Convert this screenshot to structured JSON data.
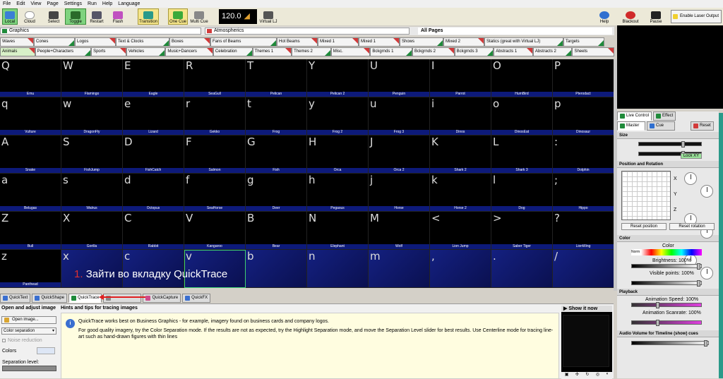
{
  "menu": [
    "File",
    "Edit",
    "View",
    "Page",
    "Settings",
    "Run",
    "Help",
    "Language"
  ],
  "toolbar": {
    "local": "Local",
    "cloud": "Cloud",
    "select": "Select",
    "toggle": "Toggle",
    "restart": "Restart",
    "flash": "Flash",
    "transition": "Transition",
    "one_cue": "One Cue",
    "multi_cue": "Multi Cue",
    "bpm": "120.0",
    "virtual_lj": "Virtual LJ",
    "help": "Help",
    "blackout": "Blackout",
    "pause": "Pause",
    "enable_output": "Enable Laser Output"
  },
  "page_bar": {
    "graphics": "Graphics",
    "atmospherics": "Atmospherics",
    "all_pages": "All Pages"
  },
  "cat_row1": [
    "Waves",
    "Cones",
    "Logos",
    "Text & Clocks",
    "Boxes",
    "Fans of Beams",
    "Hot Beams",
    "Mixed 1",
    "Mixed 1",
    "Shows",
    "Mixed 2",
    "Statics (great with Virtual LJ)",
    "Targets"
  ],
  "cat_row2": [
    "Animals",
    "People+Characters",
    "Sports",
    "Vehicles",
    "Music+Dancers",
    "Celebration",
    "Themes 1",
    "Themes 2",
    "Misc.",
    "Bckgrnds 1",
    "Bckgrnds 2",
    "Bckgrnds 3",
    "Abstracts 1",
    "Abstracts 2",
    "Sheets"
  ],
  "cues": [
    {
      "k": "Q",
      "n": "Emu"
    },
    {
      "k": "W",
      "n": "Flamingo"
    },
    {
      "k": "E",
      "n": "Eagle"
    },
    {
      "k": "R",
      "n": "SeaGull"
    },
    {
      "k": "T",
      "n": "Pelican"
    },
    {
      "k": "Y",
      "n": "Pelican 2"
    },
    {
      "k": "U",
      "n": "Penguin"
    },
    {
      "k": "I",
      "n": "Parrot"
    },
    {
      "k": "O",
      "n": "HumBird"
    },
    {
      "k": "P",
      "n": "Pterodact"
    },
    {
      "k": "q",
      "n": "Vulture"
    },
    {
      "k": "w",
      "n": "DragonFly"
    },
    {
      "k": "e",
      "n": "Lizard"
    },
    {
      "k": "r",
      "n": "Gekko"
    },
    {
      "k": "t",
      "n": "Frog"
    },
    {
      "k": "y",
      "n": "Frog 2"
    },
    {
      "k": "u",
      "n": "Frog 3"
    },
    {
      "k": "i",
      "n": "Dinos"
    },
    {
      "k": "o",
      "n": "DinosEat"
    },
    {
      "k": "p",
      "n": "Dinosaur"
    },
    {
      "k": "A",
      "n": "Snake"
    },
    {
      "k": "S",
      "n": "FishJump"
    },
    {
      "k": "D",
      "n": "FishCatch"
    },
    {
      "k": "F",
      "n": "Salmon"
    },
    {
      "k": "G",
      "n": "Fish"
    },
    {
      "k": "H",
      "n": "Orca"
    },
    {
      "k": "J",
      "n": "Orca 2"
    },
    {
      "k": "K",
      "n": "Shark 2"
    },
    {
      "k": "L",
      "n": "Shark 3"
    },
    {
      "k": ":",
      "n": "Dolphin"
    },
    {
      "k": "a",
      "n": "Belugas"
    },
    {
      "k": "s",
      "n": "Walrus"
    },
    {
      "k": "d",
      "n": "Octopus"
    },
    {
      "k": "f",
      "n": "SeaHorse"
    },
    {
      "k": "g",
      "n": "Deer"
    },
    {
      "k": "h",
      "n": "Pegasus"
    },
    {
      "k": "j",
      "n": "Horse"
    },
    {
      "k": "k",
      "n": "Horse 2"
    },
    {
      "k": "l",
      "n": "Dog"
    },
    {
      "k": ";",
      "n": "Hippo"
    },
    {
      "k": "Z",
      "n": "Bull"
    },
    {
      "k": "X",
      "n": "Gorilla"
    },
    {
      "k": "C",
      "n": "Rabbit"
    },
    {
      "k": "V",
      "n": "Kangaroo"
    },
    {
      "k": "B",
      "n": "Bear"
    },
    {
      "k": "N",
      "n": "Elephant"
    },
    {
      "k": "M",
      "n": "Wolf"
    },
    {
      "k": "<",
      "n": "Lion Jump"
    },
    {
      "k": ">",
      "n": "Saber Tiger"
    },
    {
      "k": "?",
      "n": "LionWing"
    },
    {
      "k": "z",
      "n": "Panthead"
    },
    {
      "k": "x",
      "n": ""
    },
    {
      "k": "c",
      "n": ""
    },
    {
      "k": "v",
      "n": ""
    },
    {
      "k": "b",
      "n": ""
    },
    {
      "k": "n",
      "n": ""
    },
    {
      "k": "m",
      "n": ""
    },
    {
      "k": ",",
      "n": ""
    },
    {
      "k": ".",
      "n": ""
    },
    {
      "k": "/",
      "n": ""
    }
  ],
  "annotation": {
    "num": "1.",
    "text": "Зайти во вкладку QuickTrace"
  },
  "bottom_tabs": [
    "QuickText",
    "QuickShape",
    "QuickTrace",
    "",
    "QuickCapture",
    "QuickFX"
  ],
  "trace": {
    "open_adjust": "Open and adjust image",
    "open_image": "Open image...",
    "mode": "Color separation",
    "noise": "Noise reduction",
    "colors": "Colors",
    "colors_val": "",
    "sep_level": "Separation level:",
    "hints_title": "Hints and tips for tracing images",
    "hint1": "QuickTrace works best on Business Graphics - for example, imagery found on business cards and company logos.",
    "hint2": "For good quality imagery, try the Color Separation mode. If the results are not as expected, try the Highlight Separation mode, and move the Separation Level slider for best results. Use Centerline mode for tracing line-art such as hand-drawn figures with thin lines",
    "show_now": "Show it now"
  },
  "right": {
    "live_control": "Live Control",
    "effect": "Effect",
    "master": "Master",
    "cue": "Cue",
    "reset": "Reset",
    "size": "Size",
    "lock_xy": "Lock XY",
    "pos_rot": "Position and Rotation",
    "reset_pos": "Reset position",
    "reset_rot": "Reset rotation",
    "color_sec": "Color",
    "color_lbl": "Color",
    "norm": "Norm",
    "brightness": "Brightness: 100%",
    "visible": "Visible points: 100%",
    "playback": "Playback",
    "anim_speed": "Animation Speed: 100%",
    "anim_scan": "Animation Scanrate: 100%",
    "audio": "Audio Volume for Timeline (show) cues",
    "axis_x": "X",
    "axis_y": "Y",
    "axis_z": "Z"
  },
  "colors": {
    "accent_green": "#1f8a3a",
    "flag_red": "#d23a3a",
    "cue_bar": "#0d1a7a"
  }
}
